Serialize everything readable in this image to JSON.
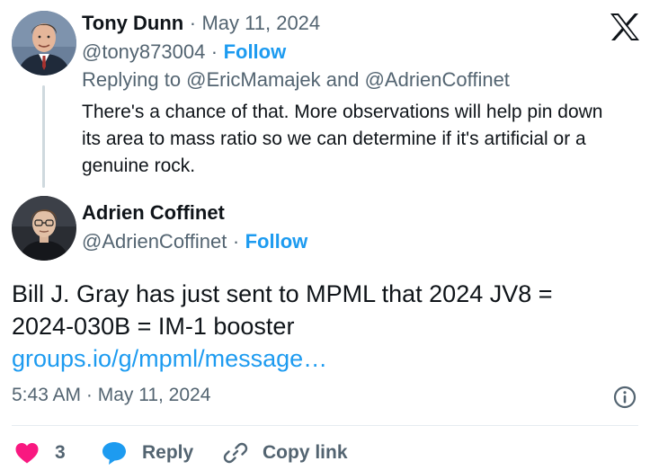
{
  "reply_tweet": {
    "author_name": "Tony Dunn",
    "date": "May 11, 2024",
    "handle": "@tony873004",
    "follow_label": "Follow",
    "separator": "·",
    "replying_to": "Replying to @EricMamajek and @AdrienCoffinet",
    "lines": [
      "There's a chance of that. More observations will help pin down",
      "its area to mass ratio so we can determine if it's artificial or a",
      "genuine rock."
    ]
  },
  "main_tweet": {
    "author_name": "Adrien Coffinet",
    "handle": "@AdrienCoffinet",
    "follow_label": "Follow",
    "separator": "·",
    "lines": [
      "Bill J. Gray has just sent to MPML that 2024 JV8 =",
      "2024-030B = IM-1 booster"
    ],
    "link": "groups.io/g/mpml/message…",
    "timestamp": "5:43 AM · May 11, 2024"
  },
  "actions": {
    "like_count": "3",
    "reply_label": "Reply",
    "copy_link_label": "Copy link"
  },
  "brand_icon": "x-logo-icon",
  "colors": {
    "accent": "#1d9bf0",
    "like": "#f91880",
    "muted": "#536471",
    "text": "#0f1419"
  }
}
